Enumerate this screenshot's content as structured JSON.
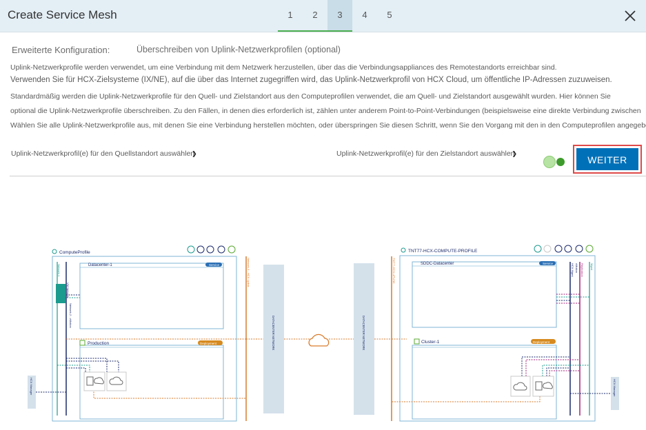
{
  "header": {
    "title": "Create Service Mesh",
    "steps": [
      "1",
      "2",
      "3",
      "4",
      "5"
    ],
    "active_step": "3"
  },
  "section": {
    "label": "Erweiterte Konfiguration:",
    "value": "Überschreiben  von  Uplink-Netzwerkprofilen  (optional)"
  },
  "description": [
    "Uplink-Netzwerkprofile werden verwendet, um eine Verbindung mit dem Netzwerk herzustellen, über das die Verbindungsappliances des Remotestandorts erreichbar sind.",
    "Verwenden Sie für HCX-Zielsysteme (IX/NE), auf die über das Internet zugegriffen wird, das Uplink-Netzwerkprofil von HCX Cloud, um öffentliche IP-Adressen zuzuweisen.",
    "Standardmäßig werden die Uplink-Netzwerkprofile für den Quell- und Zielstandort aus den Computeprofilen verwendet, die am Quell- und Zielstandort ausgewählt wurden. Hier können Sie",
    "optional die Uplink-Netzwerkprofile überschreiben. Zu den Fällen, in denen dies erforderlich ist, zählen unter anderem Point-to-Point-Verbindungen (beispielsweise eine direkte Verbindung zwischen",
    "Wählen Sie alle Uplink-Netzwerkprofile aus, mit denen Sie eine Verbindung herstellen möchten, oder überspringen Sie diesen Schritt, wenn Sie den Vorgang mit den in den Computeprofilen angegebenen"
  ],
  "selectors": {
    "source": "Uplink-Netzwerkprofil(e) für den Quellstandort auswählen",
    "target": "Uplink-Netzwerkprofil(e) für den Zielstandort auswählen"
  },
  "next_label": "WEITER",
  "diagram": {
    "left_profile": "ComputeProfile",
    "left_datacenter": "Datacenter-1",
    "left_cluster": "Production",
    "right_profile": "TNT77-HCX-COMPUTE-PROFILE",
    "right_datacenter": "SDDC-Datacenter",
    "right_cluster": "Cluster-1",
    "service_badge": "Service",
    "deployment_badge": "Deployment",
    "left_manager": "HCX Manager",
    "right_manager": "HCX Manager",
    "datacenter_network": "DATACENTER NETWORK",
    "left_net_labels": [
      "Network-1",
      "VM Network",
      "Network-2 - vMotion",
      "Network-3 - HCX Uplink"
    ],
    "right_net_labels": [
      "TNT77-HCX-UPLINK",
      "HCX Mgmt",
      "vMotion",
      "Replication",
      "Mgmt"
    ],
    "colors": {
      "orange": "#d97a2b",
      "navy": "#1b2a6b",
      "teal": "#1b9a8e",
      "magenta": "#a3217a",
      "box": "#7fb6d6",
      "network": "#d4e1eb"
    }
  }
}
